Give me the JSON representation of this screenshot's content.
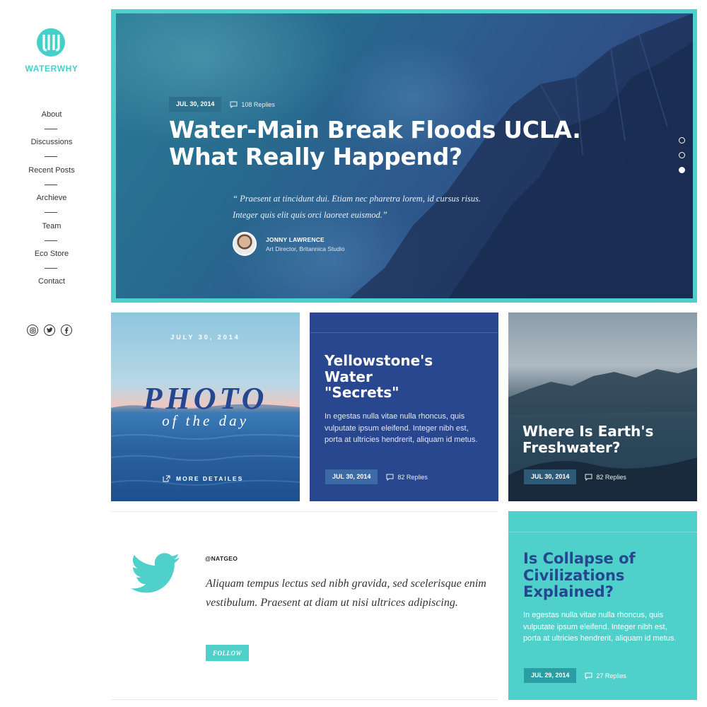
{
  "brand": {
    "name": "WATERWHY",
    "accent": "#45cfc9",
    "logo_icon": "waterwhy-logo-icon"
  },
  "nav": [
    "About",
    "Discussions",
    "Recent Posts",
    "Archieve",
    "Team",
    "Eco Store",
    "Contact"
  ],
  "socials": [
    "instagram-icon",
    "twitter-icon",
    "facebook-icon"
  ],
  "hero": {
    "date": "JUL 30, 2014",
    "replies": "108 Replies",
    "title": "Water-Main Break Floods UCLA. What Really Happend?",
    "quote_line1": "“ Praesent at tincidunt dui. Etiam nec pharetra lorem, id cursus risus.",
    "quote_line2": "Integer quis elit quis orci laoreet euismod.”",
    "author_name": "JONNY LAWRENCE",
    "author_role": "Art Director, Britannica Studio",
    "slides": 3,
    "active_slide": 3
  },
  "photo_card": {
    "date": "JULY 30, 2014",
    "word": "PHOTO",
    "sub": "of the day",
    "link": "MORE DETAILES"
  },
  "card_blue": {
    "title_line1": "Yellowstone's",
    "title_line2": "Water",
    "title_line3": "\"Secrets\"",
    "body": "In egestas nulla vitae nulla rhoncus, quis vulputate ipsum eleifend. Integer nibh est, porta at ultricies hendrerit, aliquam id metus.",
    "date": "JUL 30, 2014",
    "replies": "82 Replies",
    "color": "#28478f"
  },
  "card_mountain": {
    "title_line1": "Where Is Earth's",
    "title_line2": "Freshwater?",
    "date": "JUL 30, 2014",
    "replies": "82 Replies"
  },
  "twitter": {
    "handle": "@NATGEO",
    "tweet": "Aliquam tempus lectus sed nibh gravida, sed scelerisque enim vestibulum. Praesent at diam ut nisi ultrices adipiscing.",
    "follow": "FOLLOW"
  },
  "card_teal": {
    "title_line1": "Is Collapse of",
    "title_line2": "Civilizations",
    "title_line3": "Explained?",
    "body": "In egestas nulla vitae nulla rhoncus, quis vulputate ipsum eleifend. Integer nibh est, porta at ultricies hendrerit, aliquam id metus.",
    "date": "JUL 29, 2014",
    "replies": "27 Replies",
    "color": "#4fd0cb"
  }
}
